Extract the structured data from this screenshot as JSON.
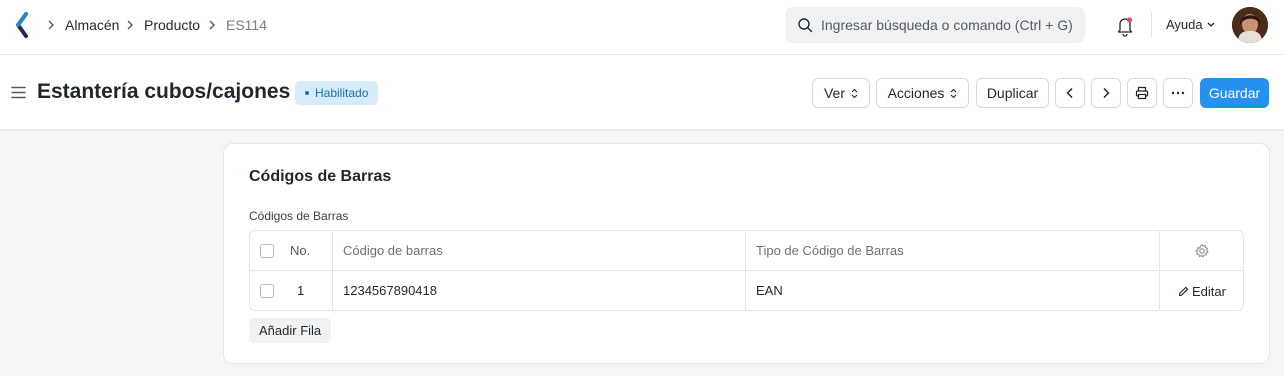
{
  "navbar": {
    "breadcrumbs": [
      "Almacén",
      "Producto",
      "ES114"
    ],
    "search_placeholder": "Ingresar búsqueda o comando (Ctrl + G)",
    "help_label": "Ayuda",
    "icons": [
      "app-logo-icon",
      "search-icon",
      "bell-icon",
      "chevron-down-icon",
      "avatar"
    ]
  },
  "page": {
    "title": "Estantería cubos/cajones",
    "status_badge": "Habilitado",
    "actions": {
      "view": "Ver",
      "actions": "Acciones",
      "duplicate": "Duplicar",
      "save": "Guardar"
    }
  },
  "section": {
    "title": "Códigos de Barras",
    "field_label": "Códigos de Barras",
    "table": {
      "columns": [
        "No.",
        "Código de barras",
        "Tipo de Código de Barras"
      ],
      "rows": [
        {
          "no": "1",
          "barcode": "1234567890418",
          "type": "EAN",
          "edit": "Editar"
        }
      ]
    },
    "add_row": "Añadir Fila"
  },
  "colors": {
    "primary": "#2490ef",
    "badge_bg": "#d6ecfb",
    "badge_text": "#1e6fad",
    "background": "#f4f5f6"
  }
}
